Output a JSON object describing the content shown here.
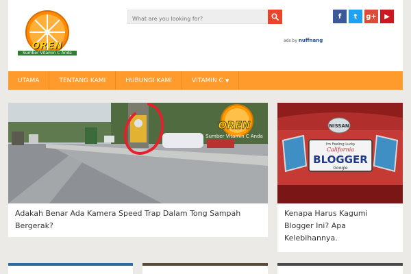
{
  "header": {
    "logo_text": "OREN",
    "logo_tagline": "Sumber Vitamin C Anda",
    "search_placeholder": "What are you looking for?",
    "ads_prefix": "ads by",
    "ads_brand": "nuffnang",
    "social": [
      {
        "icon": "facebook-icon",
        "glyph": "f"
      },
      {
        "icon": "twitter-icon",
        "glyph": "t"
      },
      {
        "icon": "google-plus-icon",
        "glyph": "g+"
      },
      {
        "icon": "youtube-icon",
        "glyph": "▶"
      }
    ]
  },
  "nav": {
    "items": [
      {
        "label": "UTAMA"
      },
      {
        "label": "TENTANG KAMI"
      },
      {
        "label": "HUBUNGI KAMI"
      },
      {
        "label": "VITAMIN C"
      }
    ]
  },
  "posts": [
    {
      "title": "Adakah Benar Ada Kamera Speed Trap Dalam Tong Sampah Bergerak?",
      "watermark": "OREN",
      "watermark_sub": "Sumber Vitamin C Anda"
    },
    {
      "title": "Kenapa Harus Kagumi Blogger Ini? Apa Kelebihannya.",
      "plate_top": "I'm Feeling Lucky",
      "plate_state": "California",
      "plate_text": "BLOGGER",
      "plate_bottom": "Google",
      "car_brand": "NISSAN"
    }
  ],
  "colors": {
    "accent": "#ff9a2c",
    "search_button": "#e8452b",
    "facebook": "#3b5998",
    "twitter": "#1da1f2",
    "google_plus": "#dd4b39",
    "youtube": "#cc181e"
  }
}
